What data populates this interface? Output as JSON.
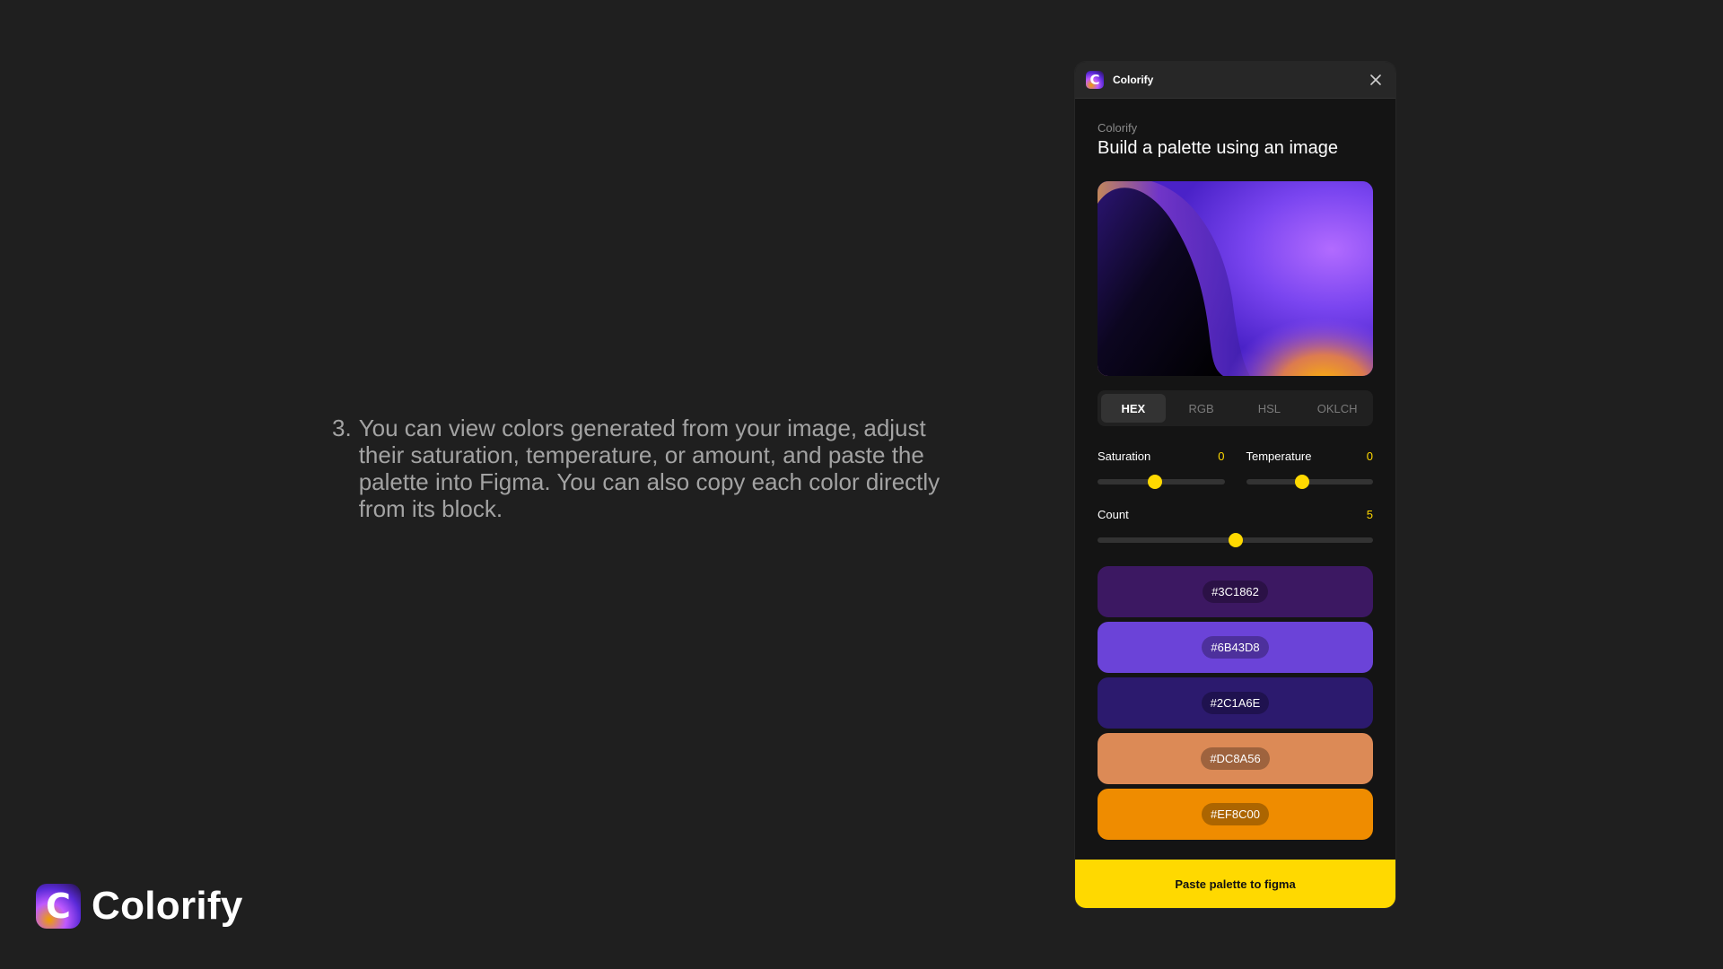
{
  "description": {
    "number": "3.",
    "text": "You can view colors generated from your image, adjust their saturation, temperature, or amount, and paste the palette into Figma. You can also copy each color directly from its block."
  },
  "brand": {
    "logo_letter": "C",
    "name": "Colorify"
  },
  "panel": {
    "window_title": "Colorify",
    "logo_letter": "C",
    "close_icon": "close-icon",
    "eyebrow": "Colorify",
    "heading": "Build a palette using an image",
    "format_tabs": [
      {
        "label": "HEX",
        "active": true
      },
      {
        "label": "RGB",
        "active": false
      },
      {
        "label": "HSL",
        "active": false
      },
      {
        "label": "OKLCH",
        "active": false
      }
    ],
    "saturation": {
      "label": "Saturation",
      "value": "0",
      "position": 0.45
    },
    "temperature": {
      "label": "Temperature",
      "value": "0",
      "position": 0.44
    },
    "count": {
      "label": "Count",
      "value": "5",
      "position": 0.5
    },
    "swatches": [
      {
        "hex": "#3C1862",
        "color": "#3C1862"
      },
      {
        "hex": "#6B43D8",
        "color": "#6B43D8"
      },
      {
        "hex": "#2C1A6E",
        "color": "#2C1A6E"
      },
      {
        "hex": "#DC8A56",
        "color": "#DC8A56"
      },
      {
        "hex": "#EF8C00",
        "color": "#EF8C00"
      }
    ],
    "cta_label": "Paste palette to figma"
  },
  "colors": {
    "background": "#1f1f1f",
    "accent": "#ffd900"
  }
}
